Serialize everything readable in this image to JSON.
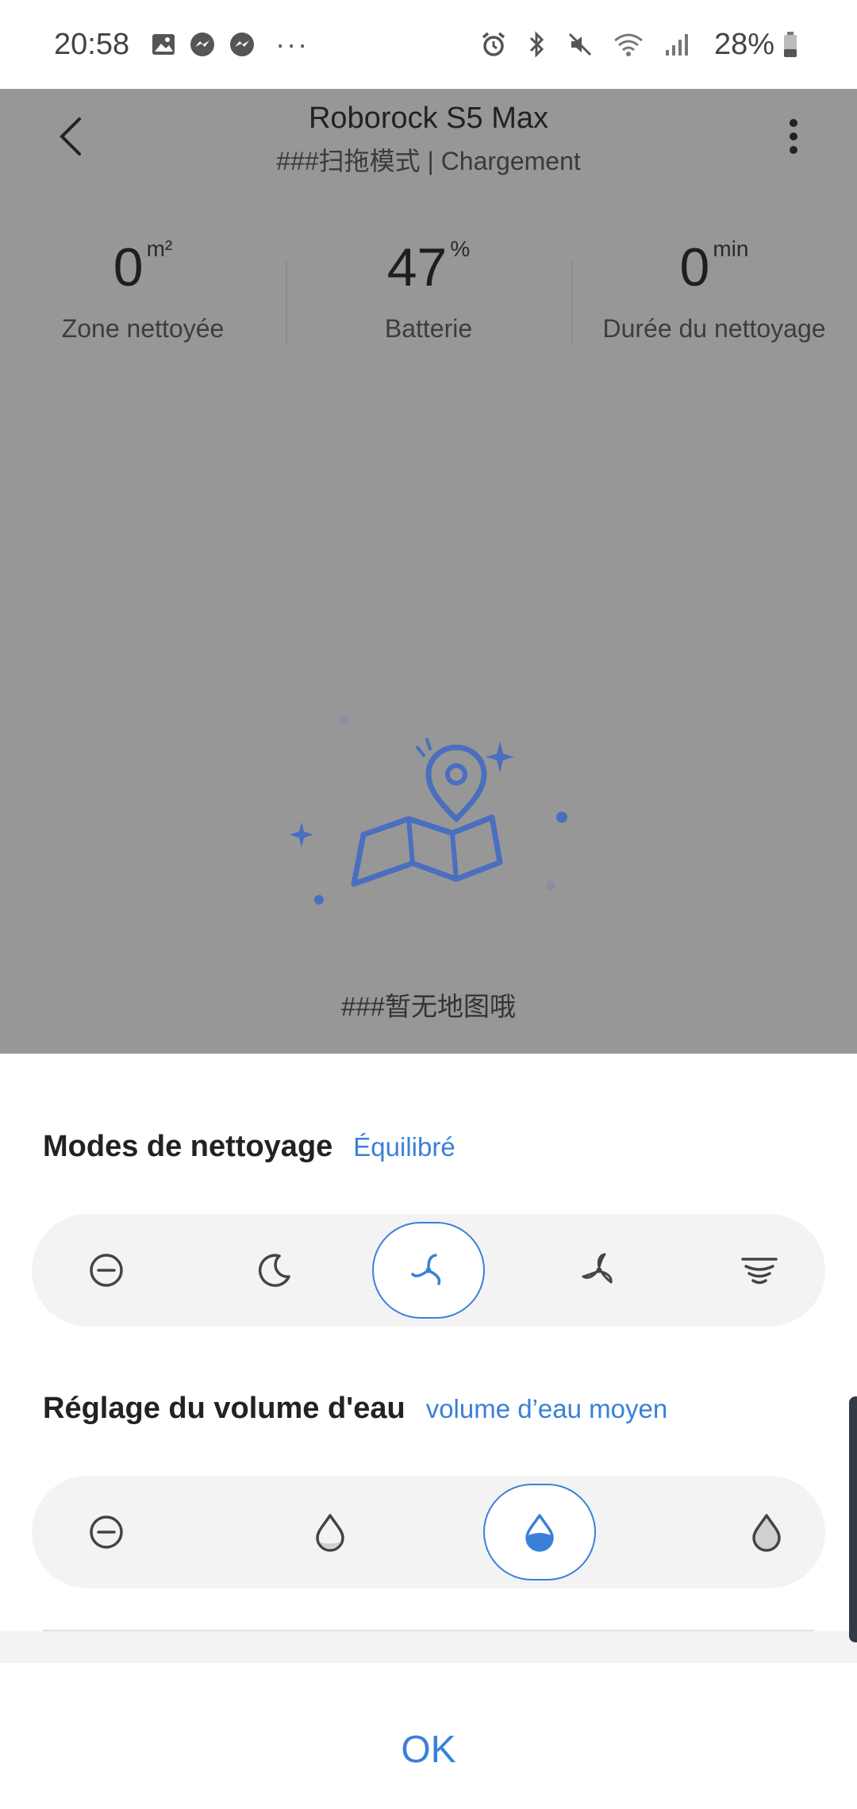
{
  "status_bar": {
    "time": "20:58",
    "battery_percent": "28%"
  },
  "header": {
    "title": "Roborock S5 Max",
    "subtitle": "###扫拖模式 | Chargement"
  },
  "stats": [
    {
      "value": "0",
      "unit": "m²",
      "label": "Zone nettoyée"
    },
    {
      "value": "47",
      "unit": "%",
      "label": "Batterie"
    },
    {
      "value": "0",
      "unit": "min",
      "label": "Durée du nettoyage"
    }
  ],
  "map": {
    "empty_text": "###暂无地图哦"
  },
  "cleaning_modes": {
    "title": "Modes de nettoyage",
    "selected_label": "Équilibré",
    "options": [
      {
        "icon": "off-icon"
      },
      {
        "icon": "quiet-moon-icon"
      },
      {
        "icon": "balanced-fan-icon",
        "active": true
      },
      {
        "icon": "turbo-fan-icon"
      },
      {
        "icon": "max-tornado-icon"
      }
    ]
  },
  "water_volume": {
    "title": "Réglage du volume d'eau",
    "selected_label": "volume d’eau moyen",
    "options": [
      {
        "icon": "off-icon"
      },
      {
        "icon": "low-water-drop-icon"
      },
      {
        "icon": "medium-water-drop-icon",
        "active": true
      },
      {
        "icon": "high-water-drop-icon"
      }
    ]
  },
  "footer": {
    "ok_label": "OK"
  },
  "colors": {
    "accent": "#3a80d9",
    "dim_overlay": "#979797",
    "map_icon_blue": "#4a74c4"
  }
}
